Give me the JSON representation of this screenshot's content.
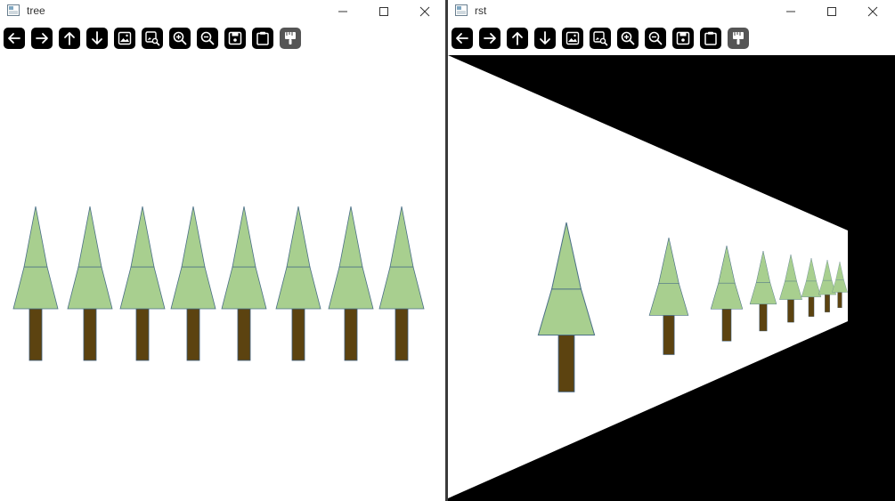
{
  "windows": [
    {
      "id": "tree",
      "title": "tree"
    },
    {
      "id": "rst",
      "title": "rst"
    }
  ],
  "toolbar_buttons": [
    {
      "icon": "arrow-left-icon"
    },
    {
      "icon": "arrow-right-icon"
    },
    {
      "icon": "arrow-up-icon"
    },
    {
      "icon": "arrow-down-icon"
    },
    {
      "icon": "image-icon"
    },
    {
      "icon": "image-search-icon"
    },
    {
      "icon": "zoom-in-icon"
    },
    {
      "icon": "zoom-out-icon"
    },
    {
      "icon": "save-icon"
    },
    {
      "icon": "clipboard-icon"
    },
    {
      "icon": "properties-icon"
    }
  ],
  "colors": {
    "foliage": "#a8cf8f",
    "foliage_stroke": "#4a6f86",
    "trunk": "#5c4310",
    "trunk_stroke": "#3a5a78",
    "background_black": "#000000",
    "toolbar_button": "#000000"
  },
  "scene": {
    "tree_count_left": 8,
    "tree_count_right": 8
  }
}
